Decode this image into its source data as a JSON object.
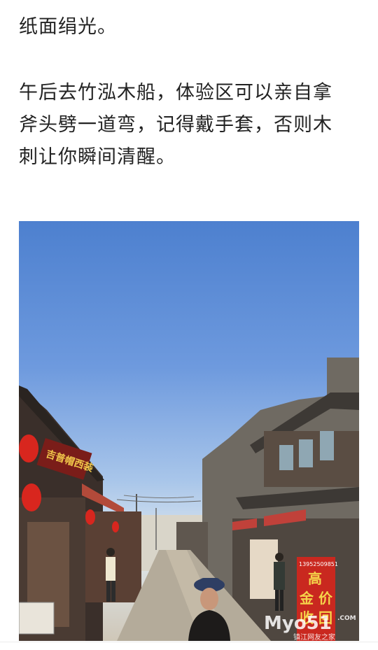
{
  "article": {
    "paragraph_1": "纸面绢光。",
    "paragraph_2": "午后去竹泓木船，体验区可以亲自拿斧头劈一道弯，记得戴手套，否则木刺让你瞬间清醒。"
  },
  "photo": {
    "signboard_left": "吉普帽西装",
    "sign_right_phone": "13952509851",
    "sign_right_line1": "高",
    "sign_right_line2": "金 价",
    "sign_right_line3": "收 回",
    "watermark_brand": "Myo51",
    "watermark_domain": ".COM",
    "watermark_sub": "镇江网友之家"
  },
  "colors": {
    "text": "#222222",
    "sky_top": "#4d80cf",
    "lantern_red": "#d8261e",
    "sign_red": "#c9281f",
    "sign_text": "#f5d34a"
  }
}
